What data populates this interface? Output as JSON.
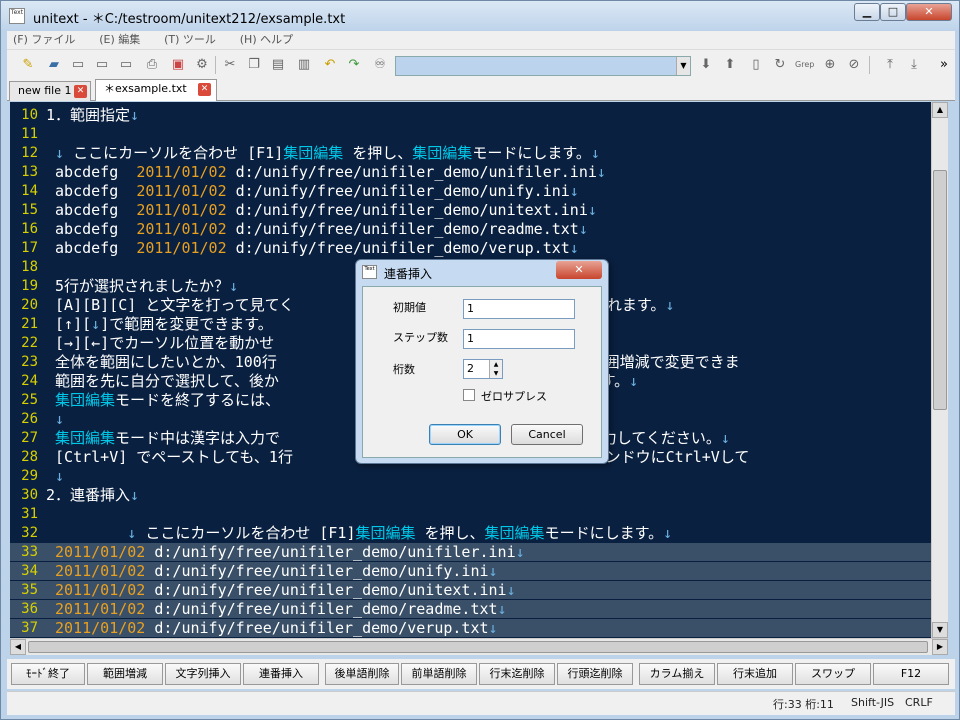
{
  "window": {
    "app_icon": "Text",
    "title": "unitext - ＊C:/testroom/unitext212/exsample.txt",
    "min_glyph": "▁",
    "max_glyph": "□",
    "close_glyph": "✕"
  },
  "menu": [
    "(F) ファイル",
    "(E) 編集",
    "(T) ツール",
    "(H) ヘルプ"
  ],
  "toolbar": {
    "search_value": "",
    "overflow": "»",
    "grep_label": "Grep"
  },
  "tabs": [
    {
      "label": "new file 1",
      "active": false
    },
    {
      "label": "＊exsample.txt",
      "active": true
    }
  ],
  "lines": [
    {
      "n": "10",
      "text": "1．範囲指定↓"
    },
    {
      "n": "11",
      "text": ""
    },
    {
      "n": "12",
      "text": " ↓ ここにカーソルを合わせ [F1]集団編集 を押し、集団編集モードにします。↓"
    },
    {
      "n": "13",
      "text": " abcdefg  2011/01/02 d:/unify/free/unifiler_demo/unifiler.ini↓"
    },
    {
      "n": "14",
      "text": " abcdefg  2011/01/02 d:/unify/free/unifiler_demo/unify.ini↓"
    },
    {
      "n": "15",
      "text": " abcdefg  2011/01/02 d:/unify/free/unifiler_demo/unitext.ini↓"
    },
    {
      "n": "16",
      "text": " abcdefg  2011/01/02 d:/unify/free/unifiler_demo/readme.txt↓"
    },
    {
      "n": "17",
      "text": " abcdefg  2011/01/02 d:/unify/free/unifiler_demo/verup.txt↓"
    },
    {
      "n": "18",
      "text": ""
    },
    {
      "n": "19",
      "text": " 5行が選択されましたか？↓"
    },
    {
      "n": "20",
      "text": " [A][B][C] と文字を打って見てく                       じ文字が入力されます。↓"
    },
    {
      "n": "21",
      "text": " [↑][↓]で範囲を変更できます。"
    },
    {
      "n": "22",
      "text": " [→][←]でカーソル位置を動かせ"
    },
    {
      "n": "23",
      "text": " 全体を範囲にしたいとか、100行                        などは、[F2]範囲増減で変更できま"
    },
    {
      "n": "24",
      "text": " 範囲を先に自分で選択して、後か                        範囲指定できます。↓"
    },
    {
      "n": "25",
      "text": " 集団編集モードを終了するには、                        了します。↓"
    },
    {
      "n": "26",
      "text": " ↓"
    },
    {
      "n": "27",
      "text": " 集団編集モード中は漢字は入力で                        ウインドウで入力してください。↓"
    },
    {
      "n": "28",
      "text": " [Ctrl+V] でペーストしても、1行                      ]文字列挿入ウインドウにCtrl+Vして"
    },
    {
      "n": "29",
      "text": " ↓"
    },
    {
      "n": "30",
      "text": "2．連番挿入↓"
    },
    {
      "n": "31",
      "text": ""
    },
    {
      "n": "32",
      "text": "         ↓ ここにカーソルを合わせ [F1]集団編集 を押し、集団編集モードにします。↓"
    },
    {
      "n": "33",
      "text": " 2011/01/02 d:/unify/free/unifiler_demo/unifiler.ini↓"
    },
    {
      "n": "34",
      "text": " 2011/01/02 d:/unify/free/unifiler_demo/unify.ini↓"
    },
    {
      "n": "35",
      "text": " 2011/01/02 d:/unify/free/unifiler_demo/unitext.ini↓"
    },
    {
      "n": "36",
      "text": " 2011/01/02 d:/unify/free/unifiler_demo/readme.txt↓"
    },
    {
      "n": "37",
      "text": " 2011/01/02 d:/unify/free/unifiler_demo/verup.txt↓"
    }
  ],
  "selected_line_numbers": [
    "33",
    "34",
    "35",
    "36",
    "37"
  ],
  "fkeys": [
    "ﾓｰﾄﾞ終了",
    "範囲増減",
    "文字列挿入",
    "連番挿入",
    "後単語削除",
    "前単語削除",
    "行末迄削除",
    "行頭迄削除",
    "カラム揃え",
    "行末追加",
    "スワップ",
    "F12"
  ],
  "status": {
    "position": "行:33 桁:11",
    "encoding": "Shift-JIS",
    "eol": "CRLF"
  },
  "dialog": {
    "title": "連番挿入",
    "close_glyph": "✕",
    "initial_label": "初期値",
    "initial_value": "1",
    "step_label": "ステップ数",
    "step_value": "1",
    "digits_label": "桁数",
    "digits_value": "2",
    "zero_suppress_label": "ゼロサプレス",
    "zero_suppress_checked": false,
    "ok_label": "OK",
    "cancel_label": "Cancel"
  },
  "colors": {
    "editor_bg": "#0a2040",
    "line_number": "#d7d000",
    "highlight": "#00c8e8",
    "date": "#e8a020",
    "selection": "#3a5068"
  }
}
